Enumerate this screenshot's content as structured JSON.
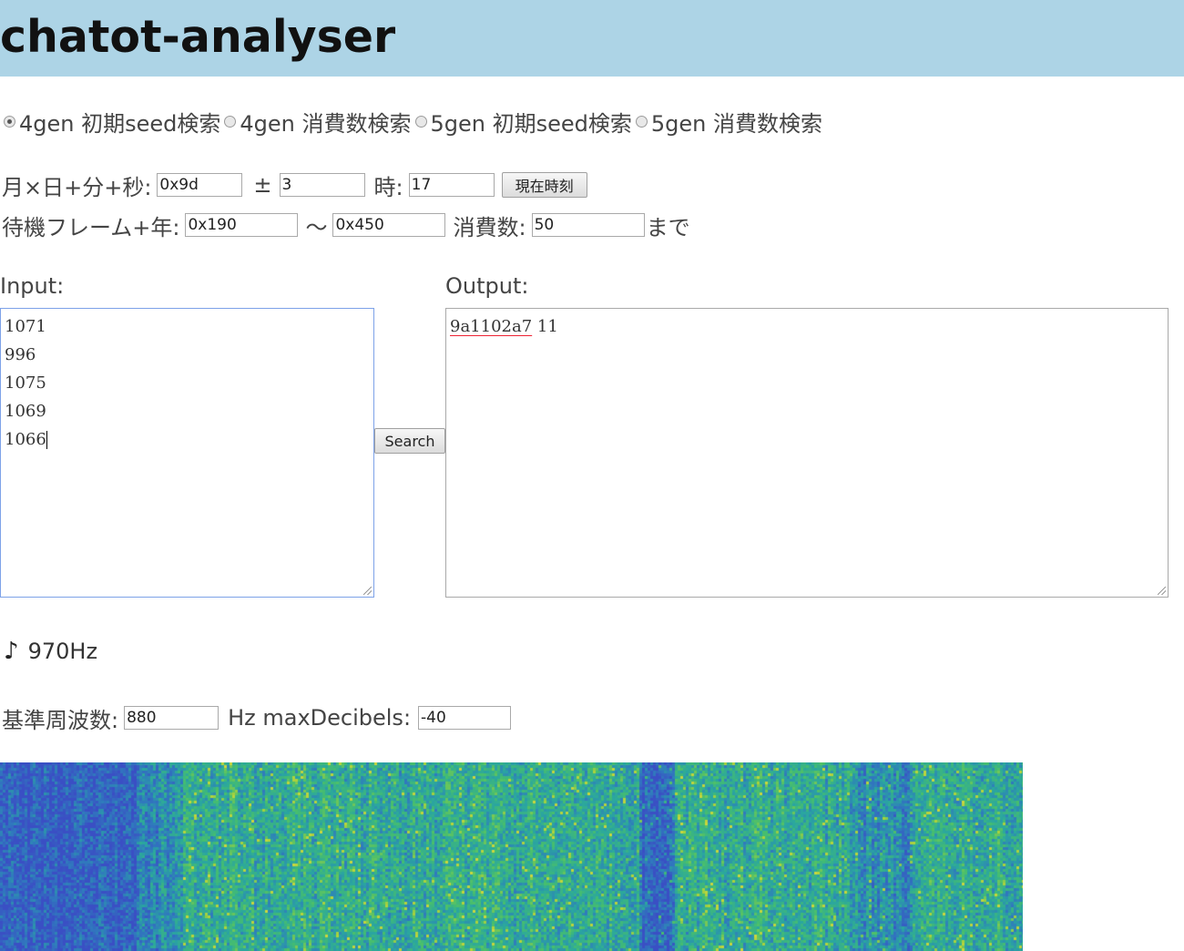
{
  "header": {
    "title": "chatot-analyser"
  },
  "modes": [
    {
      "label": "4gen 初期seed検索",
      "selected": true
    },
    {
      "label": "4gen 消費数検索",
      "selected": false
    },
    {
      "label": "5gen 初期seed検索",
      "selected": false
    },
    {
      "label": "5gen 消費数検索",
      "selected": false
    }
  ],
  "row1": {
    "date_label": "月×日+分+秒:",
    "date_value": "0x9d",
    "plusminus_label": "±",
    "plusminus_value": "3",
    "hour_label": "時:",
    "hour_value": "17",
    "now_button": "現在時刻"
  },
  "row2": {
    "frame_label": "待機フレーム+年:",
    "frame_from": "0x190",
    "tilde": "〜",
    "frame_to": "0x450",
    "consume_label": "消費数:",
    "consume_value": "50",
    "until_label": "まで"
  },
  "input": {
    "label": "Input:",
    "lines": [
      "1071",
      "996",
      "1075",
      "1069",
      "1066"
    ]
  },
  "search_button": "Search",
  "output": {
    "label": "Output:",
    "seed": "9a1102a7",
    "count": "11"
  },
  "frequency": {
    "icon": "music-note-icon",
    "glyph": "♪",
    "value": "970Hz"
  },
  "settings": {
    "base_freq_label": "基準周波数:",
    "base_freq_value": "880",
    "max_db_label": "Hz maxDecibels:",
    "max_db_value": "-40"
  },
  "colors": {
    "header_bg": "#add4e6",
    "spectrogram_low": "#3a4fc4",
    "spectrogram_mid": "#2aa6a0",
    "spectrogram_high": "#c9d93a"
  }
}
